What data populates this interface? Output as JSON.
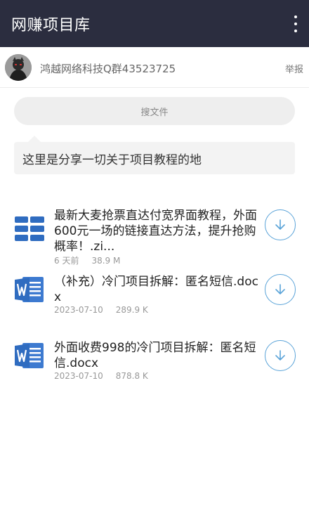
{
  "app": {
    "title": "网赚项目库",
    "menu_icon": "more-vert-icon"
  },
  "owner": {
    "name": "鸿越网络科技Q群43523725",
    "report_label": "举报"
  },
  "search": {
    "label": "搜文件"
  },
  "description": "这里是分享一切关于项目教程的地",
  "files": [
    {
      "name": "最新大麦抢票直达付宽界面教程，外面600元一场的链接直达方法，提升抢购概率！.zi...",
      "date": "6 天前",
      "size": "38.9 M",
      "icon": "archive-icon"
    },
    {
      "name": "（补充）冷门项目拆解：匿名短信.docx",
      "date": "2023-07-10",
      "size": "289.9 K",
      "icon": "word-doc-icon"
    },
    {
      "name": "外面收费998的冷门项目拆解：匿名短信.docx",
      "date": "2023-07-10",
      "size": "878.8 K",
      "icon": "word-doc-icon"
    }
  ],
  "colors": {
    "appbar": "#2b2d3f",
    "download_accent": "#5aa3d8",
    "word_blue": "#2f6cc0"
  }
}
